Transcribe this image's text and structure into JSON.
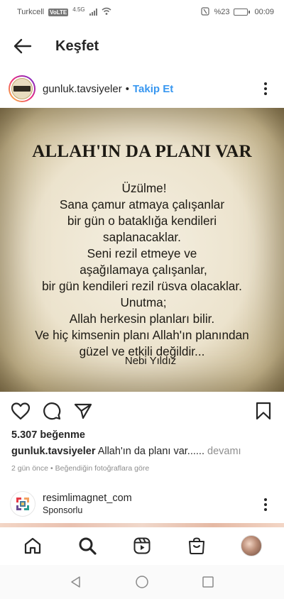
{
  "status_bar": {
    "carrier": "Turkcell",
    "volte": "VoLTE",
    "network": "4.5G",
    "battery_percent": "%23",
    "time": "00:09",
    "battery_level": 0.23
  },
  "header": {
    "title": "Keşfet"
  },
  "post": {
    "username": "gunluk.tavsiyeler",
    "separator": "•",
    "follow_label": "Takip Et",
    "image": {
      "title": "ALLAH'IN DA PLANI VAR",
      "lines": [
        "Üzülme!",
        "Sana çamur atmaya çalışanlar",
        "bir gün o bataklığa kendileri",
        "saplanacaklar.",
        "Seni rezil etmeye ve",
        "aşağılamaya çalışanlar,",
        "bir gün kendileri rezil rüsva olacaklar.",
        "Unutma;",
        "Allah herkesin planları bilir.",
        "Ve hiç kimsenin planı Allah'ın planından",
        "güzel ve etkili değildir..."
      ],
      "author": "Nebi Yıldız"
    },
    "likes": "5.307 beğenme",
    "caption_user": "gunluk.tavsiyeler",
    "caption_text": " Allah'ın da planı var......",
    "caption_more": " devamı",
    "time_ago": "2 gün önce",
    "meta_sep": "•",
    "reason": "Beğendiğin fotoğraflara göre"
  },
  "sponsored": {
    "username": "resimlimagnet_com",
    "label": "Sponsorlu"
  },
  "icons": {
    "back": "arrow-left-icon",
    "more": "more-vertical-icon",
    "like": "heart-icon",
    "comment": "comment-icon",
    "share": "send-icon",
    "save": "bookmark-icon",
    "home": "home-icon",
    "search": "search-icon",
    "reels": "reels-icon",
    "shop": "shop-icon"
  },
  "colors": {
    "follow": "#3897f0",
    "text": "#262626",
    "muted": "#8e8e8e"
  }
}
